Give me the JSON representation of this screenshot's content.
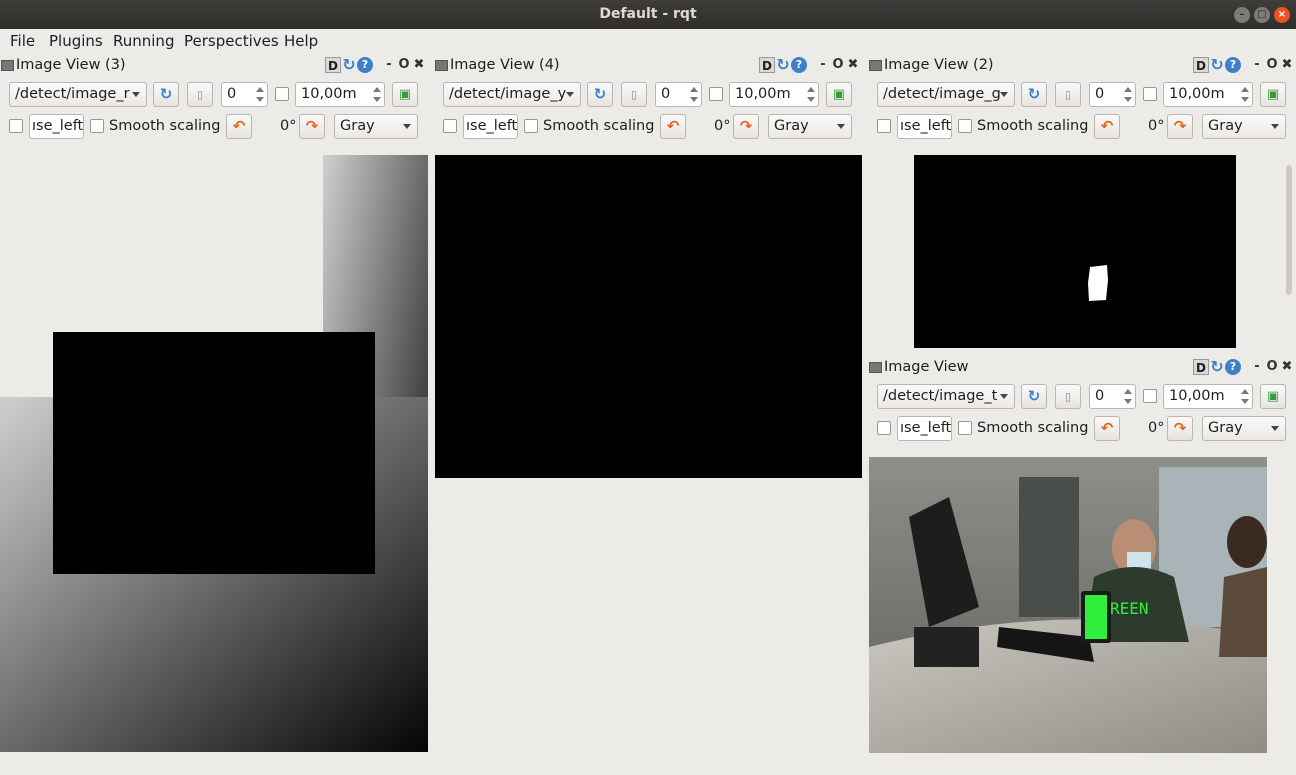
{
  "window": {
    "title": "Default - rqt"
  },
  "menu": [
    {
      "label": "File"
    },
    {
      "label": "Plugins"
    },
    {
      "label": "Running"
    },
    {
      "label": "Perspectives"
    },
    {
      "label": "Help"
    }
  ],
  "panels": [
    {
      "title": "Image View (3)",
      "topic": "/detect/image_r",
      "spin": "0",
      "duration": "10,00m",
      "text_field": "ıse_left",
      "smooth": "Smooth scaling",
      "rotation": "0°",
      "color": "Gray"
    },
    {
      "title": "Image View (4)",
      "topic": "/detect/image_y",
      "spin": "0",
      "duration": "10,00m",
      "text_field": "ıse_left",
      "smooth": "Smooth scaling",
      "rotation": "0°",
      "color": "Gray"
    },
    {
      "title": "Image View (2)",
      "topic": "/detect/image_g",
      "spin": "0",
      "duration": "10,00m",
      "text_field": "ıse_left",
      "smooth": "Smooth scaling",
      "rotation": "0°",
      "color": "Gray"
    },
    {
      "title": "Image View",
      "topic": "/detect/image_t",
      "spin": "0",
      "duration": "10,00m",
      "text_field": "ıse_left",
      "smooth": "Smooth scaling",
      "rotation": "0°",
      "color": "Gray"
    }
  ],
  "header_icons": {
    "d": "D",
    "dash": "-",
    "o": "O",
    "x": "✖"
  },
  "camera_overlay": "REEN"
}
